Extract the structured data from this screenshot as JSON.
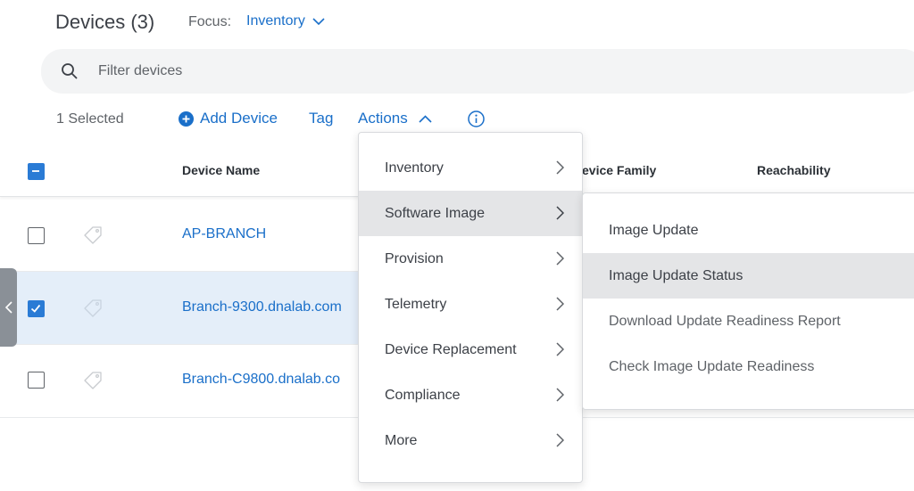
{
  "header": {
    "title": "Devices (3)",
    "focus_label": "Focus:",
    "focus_value": "Inventory"
  },
  "search": {
    "placeholder": "Filter devices"
  },
  "toolbar": {
    "selected_count": "1 Selected",
    "add_device_label": "Add Device",
    "tag_label": "Tag",
    "actions_label": "Actions"
  },
  "table": {
    "columns": [
      "Device Name",
      "evice Family",
      "Reachability"
    ],
    "rows": [
      {
        "name": "AP-BRANCH",
        "checked": false
      },
      {
        "name": "Branch-9300.dnalab.com",
        "checked": true
      },
      {
        "name": "Branch-C9800.dnalab.co",
        "checked": false
      }
    ]
  },
  "actions_menu": {
    "items": [
      {
        "label": "Inventory"
      },
      {
        "label": "Software Image"
      },
      {
        "label": "Provision"
      },
      {
        "label": "Telemetry"
      },
      {
        "label": "Device Replacement"
      },
      {
        "label": "Compliance"
      },
      {
        "label": "More"
      }
    ]
  },
  "software_image_submenu": {
    "items": [
      {
        "label": "Image Update"
      },
      {
        "label": "Image Update Status"
      },
      {
        "label": "Download Update Readiness Report"
      },
      {
        "label": "Check Image Update Readiness"
      }
    ]
  },
  "colors": {
    "accent": "#1a6fc9",
    "selected_row": "#e4eef9",
    "menu_hover": "#e4e5e7"
  }
}
